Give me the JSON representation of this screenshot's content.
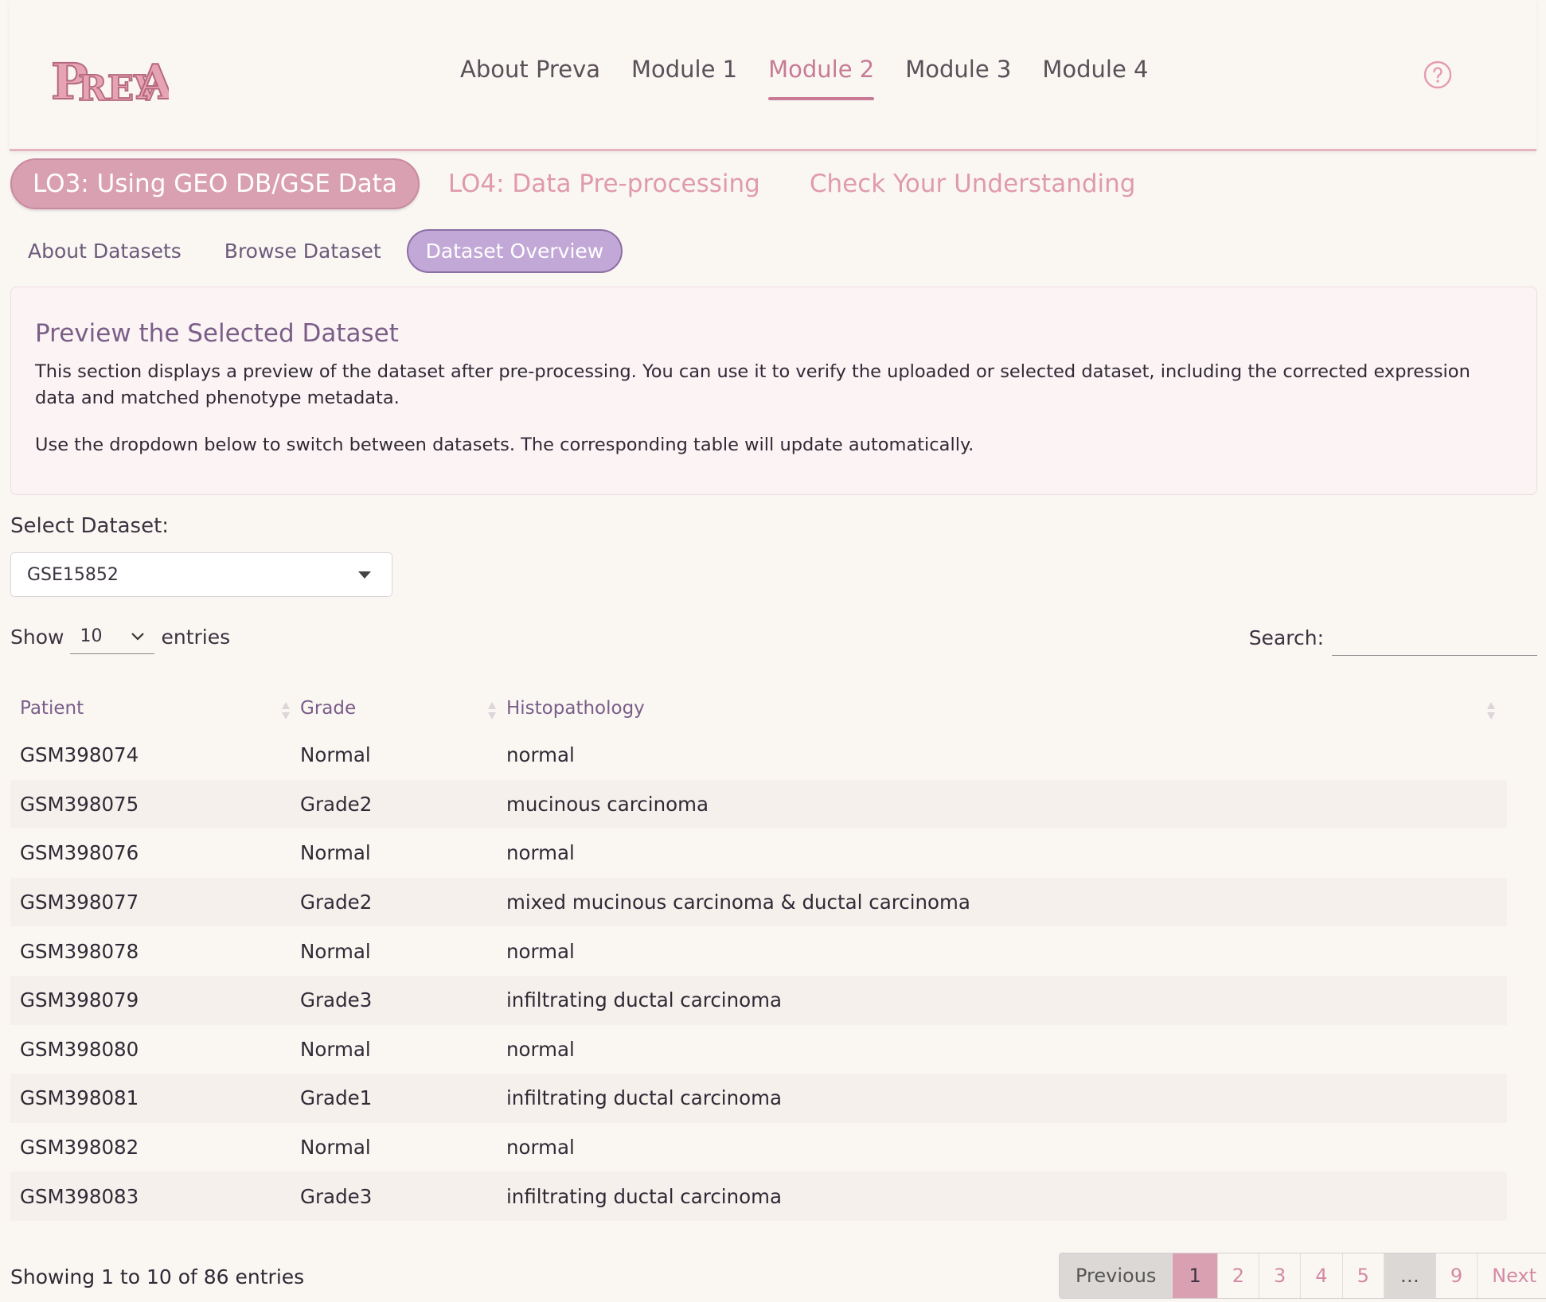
{
  "brand": {
    "logo_text": "PREVA"
  },
  "nav": {
    "items": [
      {
        "label": "About Preva"
      },
      {
        "label": "Module 1"
      },
      {
        "label": "Module 2"
      },
      {
        "label": "Module 3"
      },
      {
        "label": "Module 4"
      }
    ],
    "active_index": 2,
    "help_icon": "question-circle-icon"
  },
  "lo_tabs": [
    {
      "label": "LO3: Using GEO DB/GSE Data",
      "active": true
    },
    {
      "label": "LO4: Data Pre-processing",
      "active": false
    },
    {
      "label": "Check Your Understanding",
      "active": false
    }
  ],
  "sub_tabs": [
    {
      "label": "About Datasets",
      "active": false
    },
    {
      "label": "Browse Dataset",
      "active": false
    },
    {
      "label": "Dataset Overview",
      "active": true
    }
  ],
  "info": {
    "title": "Preview the Selected Dataset",
    "paragraph1": "This section displays a preview of the dataset after pre-processing. You can use it to verify the uploaded or selected dataset, including the corrected expression data and matched phenotype metadata.",
    "paragraph2": "Use the dropdown below to switch between datasets. The corresponding table will update automatically."
  },
  "dataset_select": {
    "label": "Select Dataset:",
    "value": "GSE15852"
  },
  "length": {
    "show_label": "Show",
    "value": "10",
    "entries_label": "entries"
  },
  "search": {
    "label": "Search:",
    "value": ""
  },
  "table": {
    "headers": [
      "Patient",
      "Grade",
      "Histopathology"
    ],
    "rows": [
      [
        "GSM398074",
        "Normal",
        "normal"
      ],
      [
        "GSM398075",
        "Grade2",
        "mucinous carcinoma"
      ],
      [
        "GSM398076",
        "Normal",
        "normal"
      ],
      [
        "GSM398077",
        "Grade2",
        "mixed mucinous carcinoma & ductal carcinoma"
      ],
      [
        "GSM398078",
        "Normal",
        "normal"
      ],
      [
        "GSM398079",
        "Grade3",
        "infiltrating ductal carcinoma"
      ],
      [
        "GSM398080",
        "Normal",
        "normal"
      ],
      [
        "GSM398081",
        "Grade1",
        "infiltrating ductal carcinoma"
      ],
      [
        "GSM398082",
        "Normal",
        "normal"
      ],
      [
        "GSM398083",
        "Grade3",
        "infiltrating ductal carcinoma"
      ]
    ]
  },
  "footer": {
    "info": "Showing 1 to 10 of 86 entries",
    "pagination": [
      "Previous",
      "1",
      "2",
      "3",
      "4",
      "5",
      "…",
      "9",
      "Next"
    ],
    "current_page": "1"
  },
  "colors": {
    "accent_pink": "#c87a96",
    "tab_pink": "#d9a0b1",
    "tab_purple": "#c2a8d6",
    "header_purple": "#7a5e88"
  }
}
